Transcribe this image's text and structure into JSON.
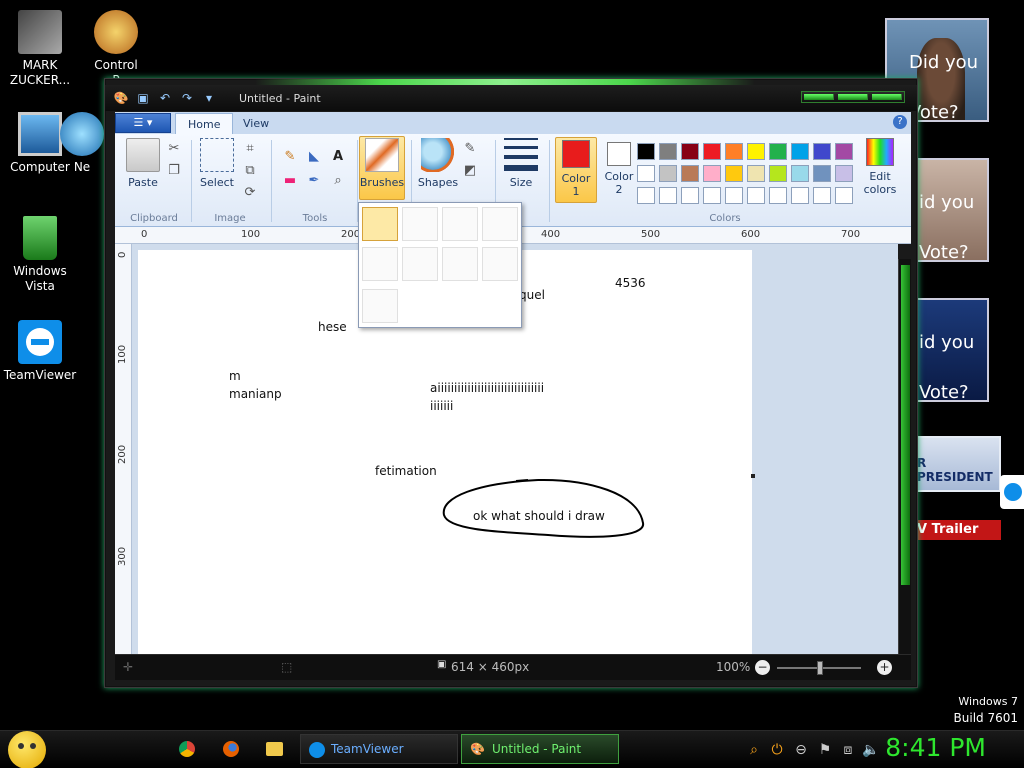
{
  "desktop": {
    "icons": [
      {
        "label": "MARK\nZUCKER..."
      },
      {
        "label": "Control\nP"
      },
      {
        "label": "Computer"
      },
      {
        "label": "Ne"
      },
      {
        "label": "Windows\nVista"
      },
      {
        "label": "TeamViewer"
      }
    ],
    "watermark_line1": "Windows 7",
    "watermark_line2": "Build 7601"
  },
  "window": {
    "title": "Untitled - Paint",
    "menu_button": "☰ ▾",
    "tabs": [
      {
        "label": "Home"
      },
      {
        "label": "View"
      }
    ],
    "help": "?"
  },
  "ribbon": {
    "paste": "Paste",
    "select": "Select",
    "brushes": "Brushes",
    "shapes": "Shapes",
    "size": "Size",
    "color1": "Color\n1",
    "color2": "Color\n2",
    "edit_colors": "Edit\ncolors",
    "groups": {
      "clipboard": "Clipboard",
      "image": "Image",
      "tools": "Tools",
      "colors": "Colors"
    },
    "color1_value": "#e81c1c",
    "color2_value": "#ffffff",
    "palette_row1": [
      "#000000",
      "#7f7f7f",
      "#880015",
      "#ed1c24",
      "#ff7f27",
      "#fff200",
      "#22b14c",
      "#00a2e8",
      "#3f48cc",
      "#a349a4"
    ],
    "palette_row2": [
      "#ffffff",
      "#c3c3c3",
      "#b97a57",
      "#ffaec9",
      "#ffc90e",
      "#efe4b0",
      "#b5e61d",
      "#99d9ea",
      "#7092be",
      "#c8bfe7"
    ]
  },
  "ruler": {
    "h_ticks": [
      "0",
      "100",
      "200",
      "400",
      "500",
      "600",
      "700"
    ],
    "v_ticks": [
      "0",
      "100",
      "200",
      "300"
    ]
  },
  "canvas_text": {
    "t1": "quel",
    "t2": "4536",
    "t3": "hese",
    "t4": "m",
    "t5": "manianp",
    "t6": "aiiiiiiiiiiiiiiiiiiiiiiiiiiiiiiii",
    "t7": "iiiiiii",
    "t8": "fetimation",
    "t9": "ok what should i draw"
  },
  "status": {
    "dimensions": "614 × 460px",
    "zoom": "100%",
    "zoom_level": 1.0
  },
  "gadgets": [
    {
      "text": "Did you\nVote?"
    },
    {
      "text": "id you\nVote?"
    },
    {
      "text": "id you\nVote?"
    },
    {
      "text": "R PRESIDENT"
    },
    {
      "text": "V Trailer"
    }
  ],
  "taskbar": {
    "buttons": [
      {
        "label": "TeamViewer"
      },
      {
        "label": "Untitled - Paint"
      }
    ],
    "clock": "8:41 PM"
  }
}
